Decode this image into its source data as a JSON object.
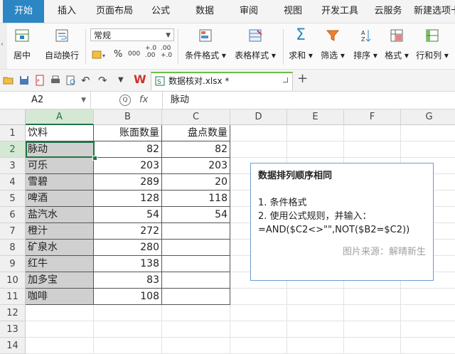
{
  "menu_tabs": [
    "开始",
    "插入",
    "页面布局",
    "公式",
    "数据",
    "审阅",
    "视图",
    "开发工具",
    "云服务",
    "新建选项卡"
  ],
  "ribbon": {
    "merge_label": "居中",
    "wrap_label": "自动换行",
    "number_format": "常规",
    "percent": "%",
    "thousands": "000",
    "inc_decimal": "+.0\n.00",
    "dec_decimal": ".00\n+.0",
    "cond_format": "条件格式",
    "table_style": "表格样式",
    "sum": "求和",
    "filter": "筛选",
    "sort": "排序",
    "format": "格式",
    "rows_cols": "行和列"
  },
  "document": {
    "tab_title": "数据核对.xlsx *"
  },
  "formula_bar": {
    "name_box": "A2",
    "fx": "fx",
    "value": "脉动"
  },
  "columns": [
    "A",
    "B",
    "C",
    "D",
    "E",
    "F",
    "G"
  ],
  "rows": [
    [
      "饮料",
      "账面数量",
      "盘点数量"
    ],
    [
      "脉动",
      "82",
      "82"
    ],
    [
      "可乐",
      "203",
      "203"
    ],
    [
      "雪碧",
      "289",
      "20"
    ],
    [
      "啤酒",
      "128",
      "118"
    ],
    [
      "盐汽水",
      "54",
      "54"
    ],
    [
      "橙汁",
      "272",
      ""
    ],
    [
      "矿泉水",
      "280",
      ""
    ],
    [
      "红牛",
      "138",
      ""
    ],
    [
      "加多宝",
      "83",
      ""
    ],
    [
      "咖啡",
      "108",
      ""
    ],
    [
      "",
      "",
      ""
    ],
    [
      "",
      "",
      ""
    ],
    [
      "",
      "",
      ""
    ]
  ],
  "note": {
    "title": "数据排列顺序相同",
    "line1": "1. 条件格式",
    "line2": "2. 使用公式规则，并输入：",
    "line3": "=AND($C2<>\"\",NOT($B2=$C2))",
    "source": "图片来源：解晴新生"
  },
  "colors": {
    "accent": "#2c86c4",
    "excel_green": "#227447",
    "gray_fill": "#d0d0d0"
  }
}
